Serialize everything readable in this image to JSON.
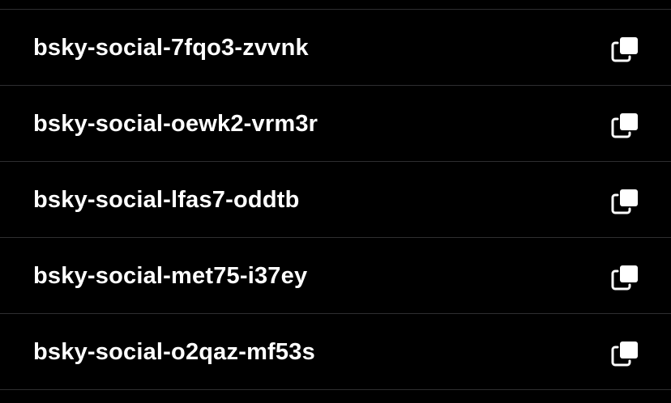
{
  "invite_codes": [
    {
      "code": "bsky-social-7fqo3-zvvnk",
      "action_icon": "copy-icon"
    },
    {
      "code": "bsky-social-oewk2-vrm3r",
      "action_icon": "copy-icon"
    },
    {
      "code": "bsky-social-lfas7-oddtb",
      "action_icon": "copy-icon"
    },
    {
      "code": "bsky-social-met75-i37ey",
      "action_icon": "copy-icon"
    },
    {
      "code": "bsky-social-o2qaz-mf53s",
      "action_icon": "copy-icon"
    }
  ],
  "colors": {
    "background": "#000000",
    "text": "#ffffff",
    "divider": "#2e2e30",
    "icon": "#ffffff"
  }
}
